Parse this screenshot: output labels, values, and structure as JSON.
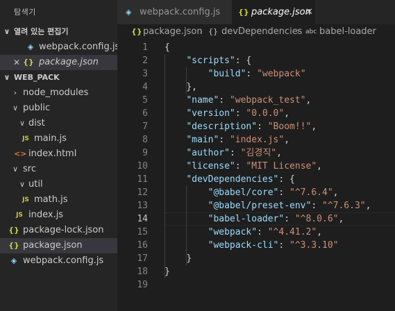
{
  "explorer": {
    "title": "탐색기",
    "open_editors": {
      "label": "열려 있는 편집기",
      "items": [
        {
          "name": "webpack.config.js",
          "icon": "webpack-icon"
        },
        {
          "name": "package.json",
          "icon": "json-icon",
          "close": "✕"
        }
      ]
    },
    "project": {
      "label": "WEB_PACK",
      "items": [
        {
          "name": "node_modules"
        },
        {
          "name": "public"
        },
        {
          "name": "dist"
        },
        {
          "name": "main.js",
          "icon_text": "JS"
        },
        {
          "name": "index.html",
          "icon_text": "<>"
        },
        {
          "name": "src"
        },
        {
          "name": "util"
        },
        {
          "name": "math.js",
          "icon_text": "JS"
        },
        {
          "name": "index.js",
          "icon_text": "JS"
        },
        {
          "name": "package-lock.json",
          "icon_text": "{}"
        },
        {
          "name": "package.json",
          "icon_text": "{}"
        },
        {
          "name": "webpack.config.js"
        }
      ]
    }
  },
  "tabs": [
    {
      "label": "webpack.config.js",
      "active": false
    },
    {
      "label": "package.json",
      "active": true,
      "close": "✕"
    }
  ],
  "breadcrumb": {
    "file": "package.json",
    "sep": "›",
    "braces": "{}",
    "section": "devDependencies",
    "abc": "abc",
    "symbol": "babel-loader"
  },
  "editor": {
    "current_line": 14,
    "lines": [
      {
        "n": "1",
        "code": "{"
      },
      {
        "n": "2",
        "code": "    \"scripts\": {"
      },
      {
        "n": "3",
        "code": "        \"build\": \"webpack\""
      },
      {
        "n": "4",
        "code": "    },"
      },
      {
        "n": "5",
        "code": "    \"name\": \"webpack_test\","
      },
      {
        "n": "6",
        "code": "    \"version\": \"0.0.0\","
      },
      {
        "n": "7",
        "code": "    \"description\": \"Boom!!\","
      },
      {
        "n": "8",
        "code": "    \"main\": \"index.js\","
      },
      {
        "n": "9",
        "code": "    \"author\": \"김경직\","
      },
      {
        "n": "10",
        "code": "    \"license\": \"MIT License\","
      },
      {
        "n": "11",
        "code": "    \"devDependencies\": {"
      },
      {
        "n": "12",
        "code": "        \"@babel/core\": \"^7.6.4\","
      },
      {
        "n": "13",
        "code": "        \"@babel/preset-env\": \"^7.6.3\","
      },
      {
        "n": "14",
        "code": "        \"babel-loader\": \"^8.0.6\","
      },
      {
        "n": "15",
        "code": "        \"webpack\": \"^4.41.2\","
      },
      {
        "n": "16",
        "code": "        \"webpack-cli\": \"^3.3.10\""
      },
      {
        "n": "17",
        "code": "    }"
      },
      {
        "n": "18",
        "code": "}"
      },
      {
        "n": "19",
        "code": ""
      }
    ]
  },
  "colors": {
    "string": "#ce9178",
    "key": "#9cdcfe",
    "punctuation": "#d4d4d4",
    "line_number": "#858585"
  }
}
